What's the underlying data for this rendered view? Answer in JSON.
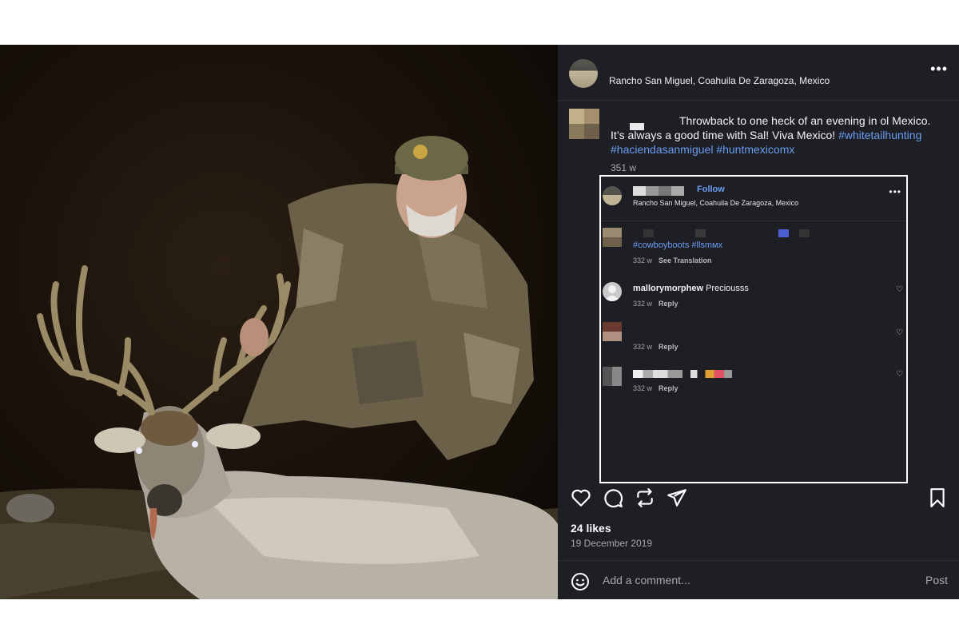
{
  "post": {
    "location": "Rancho San Miguel, Coahuila De Zaragoza, Mexico",
    "more_label": "•••",
    "caption": {
      "line1": "Throwback to one heck of an evening in ol Mexico.",
      "line2_a": "It",
      "line2_b": "s always a good time with Sal! Viva Mexico!",
      "hashtag1": "#whitetailhunting",
      "hashtag2": "#haciendasanmiguel",
      "hashtag3": "#huntmexicomx"
    },
    "age": "351 w",
    "likes": "24 likes",
    "date": "19 December 2019",
    "add_comment_placeholder": "Add a comment...",
    "post_button": "Post"
  },
  "embed": {
    "follow_label": "Follow",
    "location": "Rancho San Miguel, Coahuila De Zaragoza, Mexico",
    "more_label": "•••",
    "caption_tags": "#cowboyboots #llsmмx",
    "caption_meta_age": "332 w",
    "caption_meta_action": "See Translation",
    "comments": [
      {
        "user": "mallorymorphew",
        "text": "Preciousss",
        "age": "332 w",
        "action": "Reply"
      },
      {
        "user": "",
        "text": "",
        "age": "332 w",
        "action": "Reply"
      },
      {
        "user": "",
        "text": "",
        "age": "332 w",
        "action": "Reply"
      }
    ]
  },
  "icons": [
    "heart-icon",
    "comment-icon",
    "repost-icon",
    "share-icon",
    "bookmark-icon",
    "emoji-icon"
  ],
  "colors": {
    "panel_bg": "#1d1f25",
    "link": "#6a9cf0",
    "text": "#f5f5f5",
    "muted": "#a8a8a8"
  }
}
